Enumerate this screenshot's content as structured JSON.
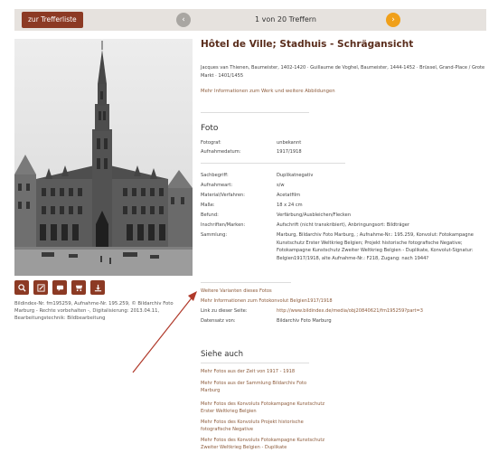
{
  "topbar": {
    "back_label": "zur Trefferliste",
    "counter": "1 von 20 Treffern",
    "prev_icon": "chevron-left-icon",
    "next_icon": "chevron-right-icon",
    "accent": "#8c3a24",
    "next_color": "#f0a01a"
  },
  "image": {
    "tool_icons": [
      "zoom-icon",
      "edit-icon",
      "comment-icon",
      "cart-icon",
      "download-icon"
    ],
    "caption": "Bildindex-Nr. fm195259, Aufnahme-Nr. 195.259, © Bildarchiv Foto Marburg - Rechte vorbehalten -, Digitalisierung: 2013.04.11, Bearbeitungstechnik: Bildbearbeitung"
  },
  "work": {
    "title": "Hôtel de Ville; Stadhuis - Schrägansicht",
    "creators": "Jacques van Thienen, Baumeister, 1402-1420 · Guillaume de Voghel, Baumeister, 1444-1452 · Brüssel, Grand-Place / Grote Markt · 1401/1455",
    "more_info": "Mehr Informationen zum Werk und weitere Abbildungen"
  },
  "foto": {
    "heading": "Foto",
    "rows_a": [
      {
        "label": "Fotograf:",
        "value": "unbekannt"
      },
      {
        "label": "Aufnahmedatum:",
        "value": "1917/1918"
      }
    ],
    "rows_b": [
      {
        "label": "Sachbegriff:",
        "value": "Duplikatnegativ"
      },
      {
        "label": "Aufnahmeart:",
        "value": "s/w"
      },
      {
        "label": "Material/Verfahren:",
        "value": "Acetatfilm"
      },
      {
        "label": "Maße:",
        "value": "18 x 24 cm"
      },
      {
        "label": "Befund:",
        "value": "Verfärbung/Ausbleichen/Flecken"
      },
      {
        "label": "Inschriften/Marken:",
        "value": "Aufschrift (nicht transkribiert), Anbringungsort: Bildträger"
      },
      {
        "label": "Sammlung:",
        "value": "Marburg, Bildarchiv Foto Marburg, ; Aufnahme-Nr.: 195.259, Konvolut: Fotokampagne Kunstschutz Erster Weltkrieg Belgien; Projekt historische fotografische Negative; Fotokampagne Kunstschutz Zweiter Weltkrieg Belgien - Duplikate, Konvolut-Signatur: Belgien1917/1918, alte Aufnahme-Nr.: F218, Zugang: nach 1944?"
      }
    ],
    "variants_link": "Weitere Varianten dieses Fotos",
    "konvolut_link": "Mehr Informationen zum Fotokonvolut Belgien1917/1918",
    "link_label": "Link zu dieser Seite:",
    "link_value": "http://www.bildindex.de/media/obj20840621/fm195259?part=3",
    "owner_label": "Datensatz von:",
    "owner_value": "Bildarchiv Foto Marburg"
  },
  "siehe": {
    "heading": "Siehe auch",
    "items": [
      "Mehr Fotos aus der Zeit von 1917 - 1918",
      "Mehr Fotos aus der Sammlung Bildarchiv Foto Marburg",
      "Mehr Fotos des Konvoluts Fotokampagne Kunstschutz Erster Weltkrieg Belgien",
      "Mehr Fotos des Konvoluts Projekt historische fotografische Negative",
      "Mehr Fotos des Konvoluts Fotokampagne Kunstschutz Zweiter Weltkrieg Belgien - Duplikate"
    ]
  }
}
